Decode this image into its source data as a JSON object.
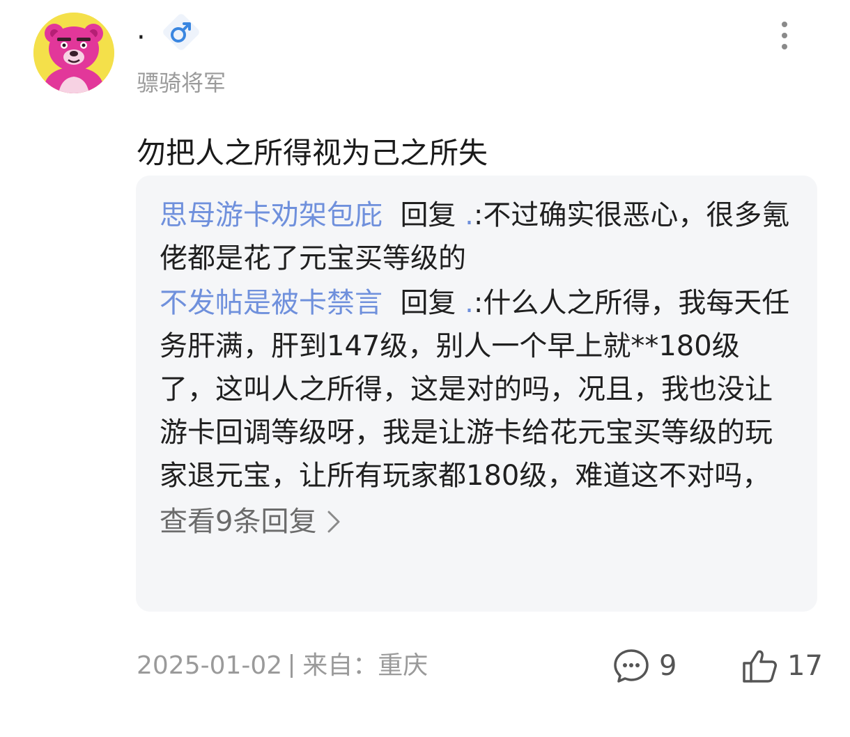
{
  "header": {
    "user_name": "·",
    "gender_symbol": "♂",
    "user_title": "骠骑将军"
  },
  "post": {
    "text": "勿把人之所得视为己之所失"
  },
  "replies": {
    "items": [
      {
        "user": "思母游卡劝架包庇",
        "action": "回复",
        "target": ".",
        "separator": ":",
        "text": "不过确实很恶心，很多氪佬都是花了元宝买等级的"
      },
      {
        "user": "不发帖是被卡禁言",
        "action": "回复",
        "target": ".",
        "separator": ":",
        "text": "什么人之所得，我每天任务肝满，肝到147级，别人一个早上就**180级了，这叫人之所得，这是对的吗，况且，我也没让游卡回调等级呀，我是让游卡给花元宝买等级的玩家退元宝，让所有玩家都180级，难道这不对吗，"
      }
    ],
    "view_more": "查看9条回复"
  },
  "footer": {
    "date": "2025-01-02",
    "location": "来自：重庆",
    "comment_count": "9",
    "like_count": "17"
  },
  "colors": {
    "link_blue": "#6f90dc",
    "meta_gray": "#9a9a9a",
    "card_bg": "#f5f6f8",
    "avatar_bg": "#f4e04a",
    "avatar_bear": "#e2379a"
  }
}
